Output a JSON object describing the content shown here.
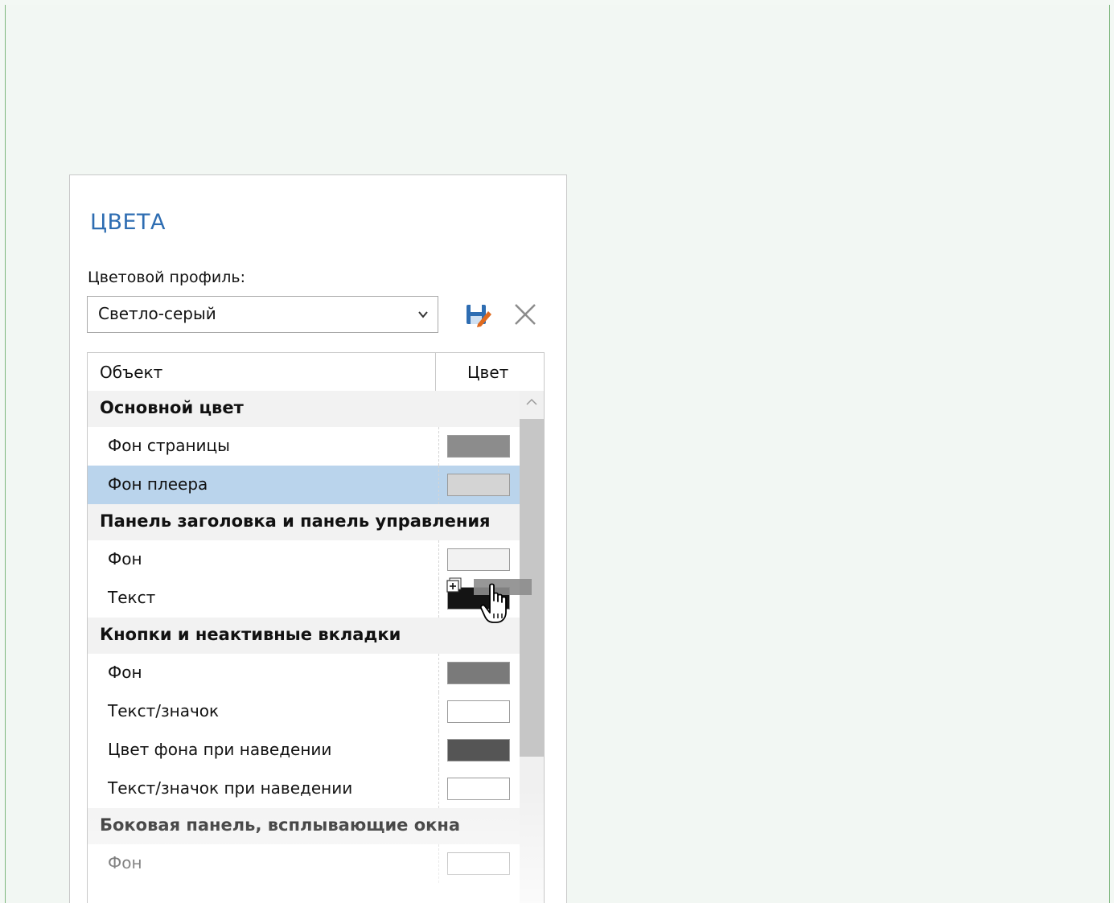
{
  "panel": {
    "title": "ЦВЕТА",
    "profile_label": "Цветовой профиль:",
    "profile_value": "Светло-серый",
    "save_icon": "save-edit-icon",
    "close_icon": "close-icon"
  },
  "table": {
    "col_object": "Объект",
    "col_color": "Цвет",
    "groups": [
      {
        "label": "Основной цвет",
        "items": [
          {
            "label": "Фон страницы",
            "color": "#8c8c8c"
          },
          {
            "label": "Фон плеера",
            "color": "#d4d4d4",
            "selected": true
          }
        ]
      },
      {
        "label": "Панель заголовка и панель управления",
        "items": [
          {
            "label": "Фон",
            "color": "#f2f2f2"
          },
          {
            "label": "Текст",
            "color": "#141414"
          }
        ]
      },
      {
        "label": "Кнопки и неактивные вкладки",
        "items": [
          {
            "label": "Фон",
            "color": "#7a7a7a"
          },
          {
            "label": "Текст/значок",
            "color": "#ffffff"
          },
          {
            "label": "Цвет фона при наведении",
            "color": "#555555"
          },
          {
            "label": "Текст/значок при наведении",
            "color": "#ffffff"
          }
        ]
      },
      {
        "label": "Боковая панель, всплывающие окна",
        "items": [
          {
            "label": "Фон",
            "color": "#ffffff"
          }
        ]
      }
    ]
  },
  "colors": {
    "accent": "#2e6db2",
    "selection": "#bad4ec",
    "frame": "#7cb67c"
  }
}
